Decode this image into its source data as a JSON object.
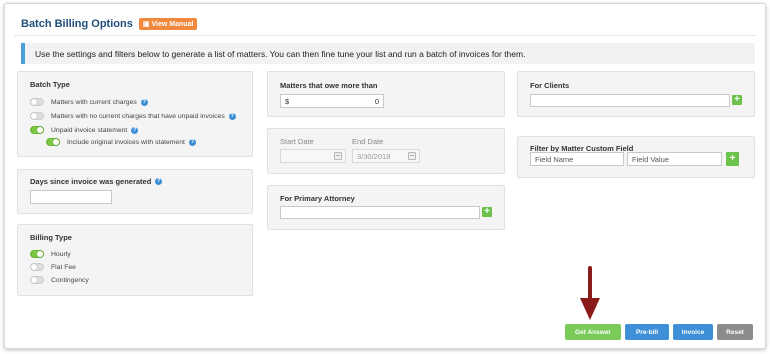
{
  "header": {
    "title": "Batch Billing Options",
    "manual_label": "View Manual",
    "info": "Use the settings and filters below to generate a list of matters. You can then fine tune your list and run a batch of invoices for them."
  },
  "batch_type": {
    "title": "Batch Type",
    "options": [
      {
        "label": "Matters with current charges",
        "on": false
      },
      {
        "label": "Matters with no current charges that have unpaid invoices",
        "on": false
      },
      {
        "label": "Unpaid invoice statement",
        "on": true
      },
      {
        "label": "Include original invoices with statement",
        "on": true
      }
    ]
  },
  "days_since": {
    "title": "Days since invoice was generated",
    "value": ""
  },
  "billing_type": {
    "title": "Billing Type",
    "options": [
      {
        "label": "Hourly",
        "on": true
      },
      {
        "label": "Flat Fee",
        "on": false
      },
      {
        "label": "Contingency",
        "on": false
      }
    ]
  },
  "owe_more": {
    "title": "Matters that owe more than",
    "currency": "$",
    "value": "0"
  },
  "dates": {
    "start_label": "Start Date",
    "end_label": "End Date",
    "start_value": "",
    "end_value": "3/30/2018"
  },
  "attorney": {
    "title": "For Primary Attorney",
    "value": ""
  },
  "clients": {
    "title": "For Clients",
    "value": ""
  },
  "custom_field": {
    "title": "Filter by Matter Custom Field",
    "name_placeholder": "Field Name",
    "value_placeholder": "Field Value"
  },
  "actions": {
    "get_answer": "Get Answer",
    "prebill": "Pre-bill",
    "invoice": "Invoice",
    "reset": "Reset"
  },
  "colors": {
    "accent_blue": "#3e8fd6",
    "green": "#6cc24a",
    "orange": "#f0883e",
    "arrow": "#8b1a1a",
    "gray": "#8c8c8c"
  }
}
